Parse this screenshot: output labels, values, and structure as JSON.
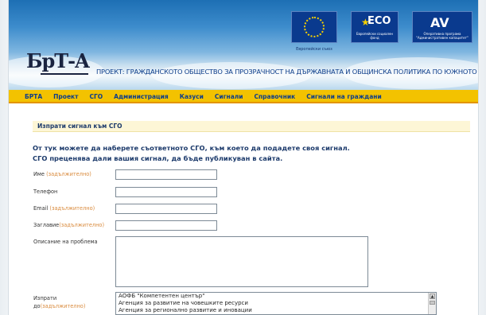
{
  "header": {
    "logo_text": "БрТ-A",
    "project_title": "ПРОЕКТ: ГРАЖДАНСКОТО ОБЩЕСТВО ЗА ПРОЗРАЧНОСТ НА ДЪРЖАВНАТА И ОБЩИНСКА ПОЛИТИКА ПО ЮЖНОТО ЧЕРНОМОРИЕ",
    "badges": [
      {
        "name": "eu-flag",
        "caption": "Европейски съюз"
      },
      {
        "name": "eco",
        "text": "ECO",
        "caption": "Европейски социален фонд"
      },
      {
        "name": "op",
        "text": "AV",
        "caption": "Оперативна програма \"Административен капацитет\""
      }
    ]
  },
  "nav": {
    "items": [
      "БРТА",
      "Проект",
      "СГО",
      "Администрация",
      "Казуси",
      "Сигнали",
      "Справочник",
      "Сигнали на граждани"
    ]
  },
  "content": {
    "section_title": "Изпрати сигнал към СГО",
    "intro_line1": "От тук можете да наберете съответното СГО, към което да подадете своя сигнал.",
    "intro_line2": "СГО преценява дали вашия сигнал, да бъде публикуван в сайта."
  },
  "form": {
    "name_label": "Име",
    "name_req": "(задължително)",
    "name_value": "",
    "phone_label": "Телефон",
    "phone_value": "",
    "email_label": "Email",
    "email_req": "(задължително)",
    "email_value": "",
    "title_label": "Заглавие",
    "title_req": "(задължително)",
    "title_value": "",
    "description_label": "Описание на проблема",
    "description_value": "",
    "send_to_label_1": "Изпрати",
    "send_to_label_2": "до",
    "send_to_req": "(задължително)",
    "send_to_options": [
      "АОФБ \"Компетентен център\"",
      "Агенция за развитие на човешките ресурси",
      "Агенция за регионално развитие и иновации"
    ]
  },
  "colors": {
    "header_blue": "#1d6fb4",
    "nav_yellow": "#f3c200",
    "nav_text": "#0d3d8a",
    "required_orange": "#d98a3c"
  }
}
